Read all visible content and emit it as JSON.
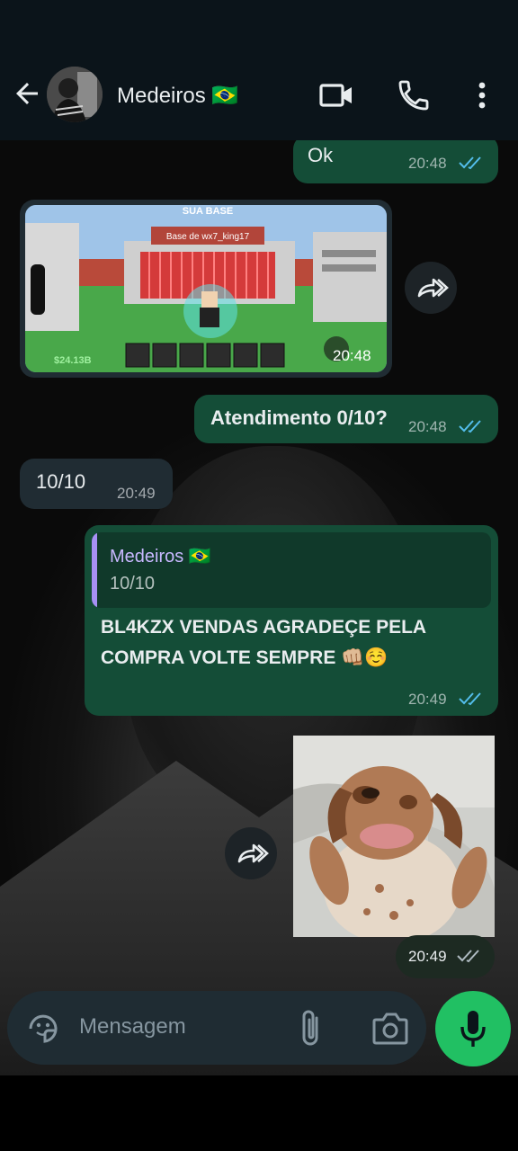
{
  "header": {
    "contact_name": "Medeiros 🇧🇷"
  },
  "messages": [
    {
      "type": "text",
      "direction": "out",
      "text": "Ok",
      "time": "20:48",
      "status": "read"
    },
    {
      "type": "image",
      "direction": "in",
      "time": "20:48",
      "game_label": "Base de wx7_king17",
      "game_banner": "SUA BASE",
      "game_money": "$24.13B"
    },
    {
      "type": "text",
      "direction": "out",
      "text": "Atendimento 0/10?",
      "time": "20:48",
      "status": "read"
    },
    {
      "type": "text",
      "direction": "in",
      "text": "10/10",
      "time": "20:49"
    },
    {
      "type": "reply",
      "direction": "out",
      "quoted_author": "Medeiros 🇧🇷",
      "quoted_text": "10/10",
      "text_line1": "BL4KZX VENDAS AGRADEÇE PELA",
      "text_line2": "COMPRA VOLTE SEMPRE",
      "emoji": "👊🏼☺️",
      "time": "20:49",
      "status": "read"
    },
    {
      "type": "image",
      "direction": "out",
      "time": "20:49",
      "status": "delivered"
    }
  ],
  "composer": {
    "placeholder": "Mensagem"
  },
  "colors": {
    "outgoing_bubble": "#144d37",
    "incoming_bubble": "#202c33",
    "read_ticks": "#53bdeb",
    "mic_button": "#21c063"
  }
}
